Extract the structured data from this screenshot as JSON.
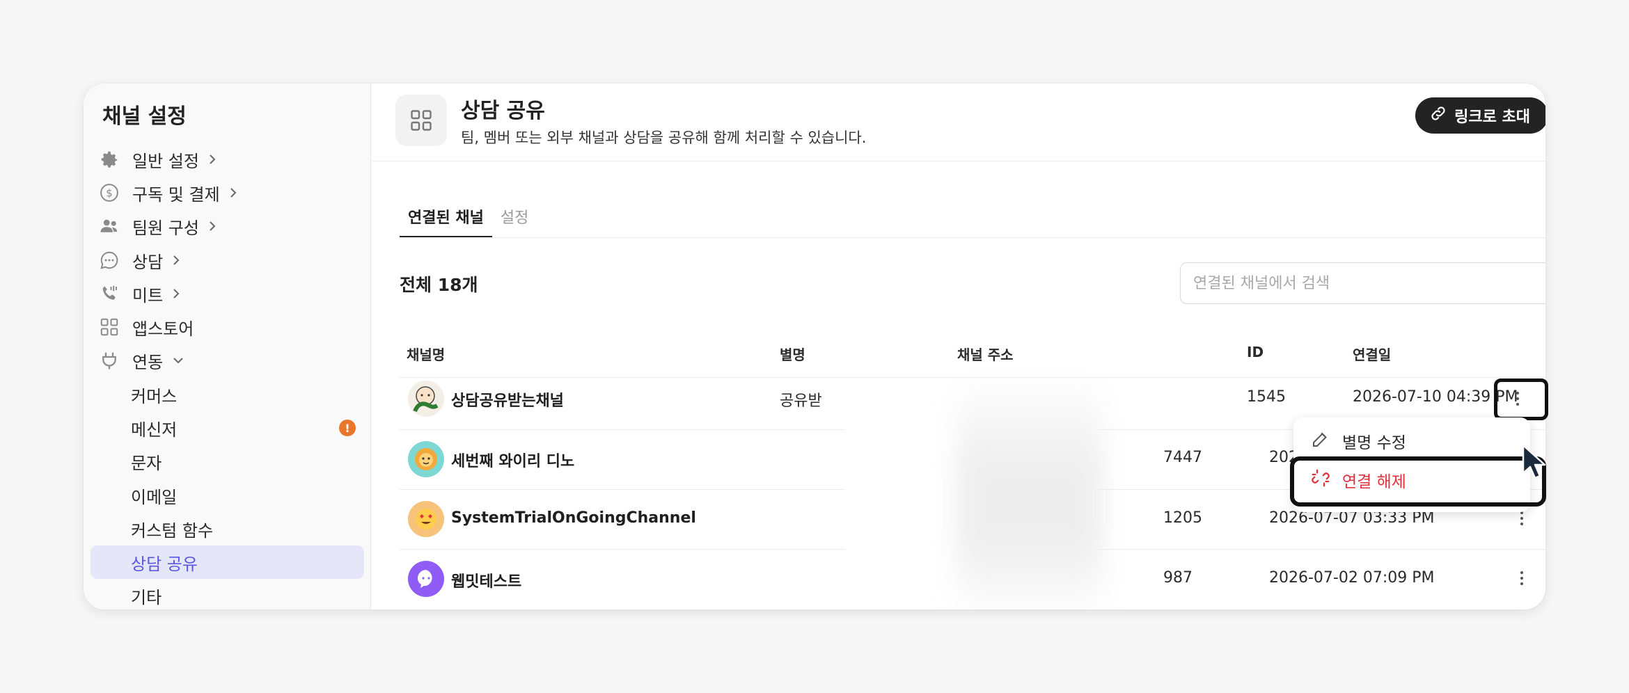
{
  "sidebar": {
    "title": "채널 설정",
    "items": [
      {
        "label": "일반 설정",
        "icon": "gear-icon"
      },
      {
        "label": "구독 및 결제",
        "icon": "dollar-circle-icon"
      },
      {
        "label": "팀원 구성",
        "icon": "people-icon"
      },
      {
        "label": "상담",
        "icon": "chat-bubble-icon"
      },
      {
        "label": "미트",
        "icon": "phone-icon"
      },
      {
        "label": "앱스토어",
        "icon": "grid-icon"
      },
      {
        "label": "연동",
        "icon": "plug-icon"
      }
    ],
    "subitems": [
      {
        "label": "커머스"
      },
      {
        "label": "메신저",
        "badge": "!"
      },
      {
        "label": "문자"
      },
      {
        "label": "이메일"
      },
      {
        "label": "커스텀 함수"
      },
      {
        "label": "상담 공유",
        "active": true
      },
      {
        "label": "기타"
      }
    ]
  },
  "header": {
    "title": "상담 공유",
    "description": "팀, 멤버 또는 외부 채널과 상담을 공유해 함께 처리할 수 있습니다.",
    "invite_label": "링크로 초대"
  },
  "tabs": [
    {
      "label": "연결된 채널",
      "active": true
    },
    {
      "label": "설정",
      "active": false
    }
  ],
  "total_count": "전체 18개",
  "search": {
    "placeholder": "연결된 채널에서 검색",
    "value": ""
  },
  "table": {
    "columns": [
      "채널명",
      "별명",
      "채널 주소",
      "ID",
      "연결일"
    ],
    "rows": [
      {
        "name": "상담공유받는채널",
        "nickname": "공유받",
        "id": "1545",
        "date": "2026-07-10 04:39 PM"
      },
      {
        "name": "세번째 와이리 디노",
        "nickname": "",
        "id": "7447",
        "date": "202"
      },
      {
        "name": "SystemTrialOnGoingChannel",
        "nickname": "",
        "id": "1205",
        "date": "2026-07-07 03:33 PM"
      },
      {
        "name": "웹밋테스트",
        "nickname": "",
        "id": "987",
        "date": "2026-07-02 07:09 PM"
      }
    ]
  },
  "context_menu": {
    "items": [
      {
        "label": "별명 수정",
        "icon": "edit-icon"
      },
      {
        "label": "연결 해제",
        "icon": "unlink-icon",
        "color": "#e0313a"
      }
    ]
  },
  "colors": {
    "accent": "#5b57e0",
    "active_bg": "#e6e6f9",
    "danger": "#e0313a",
    "warning": "#e8772c"
  }
}
